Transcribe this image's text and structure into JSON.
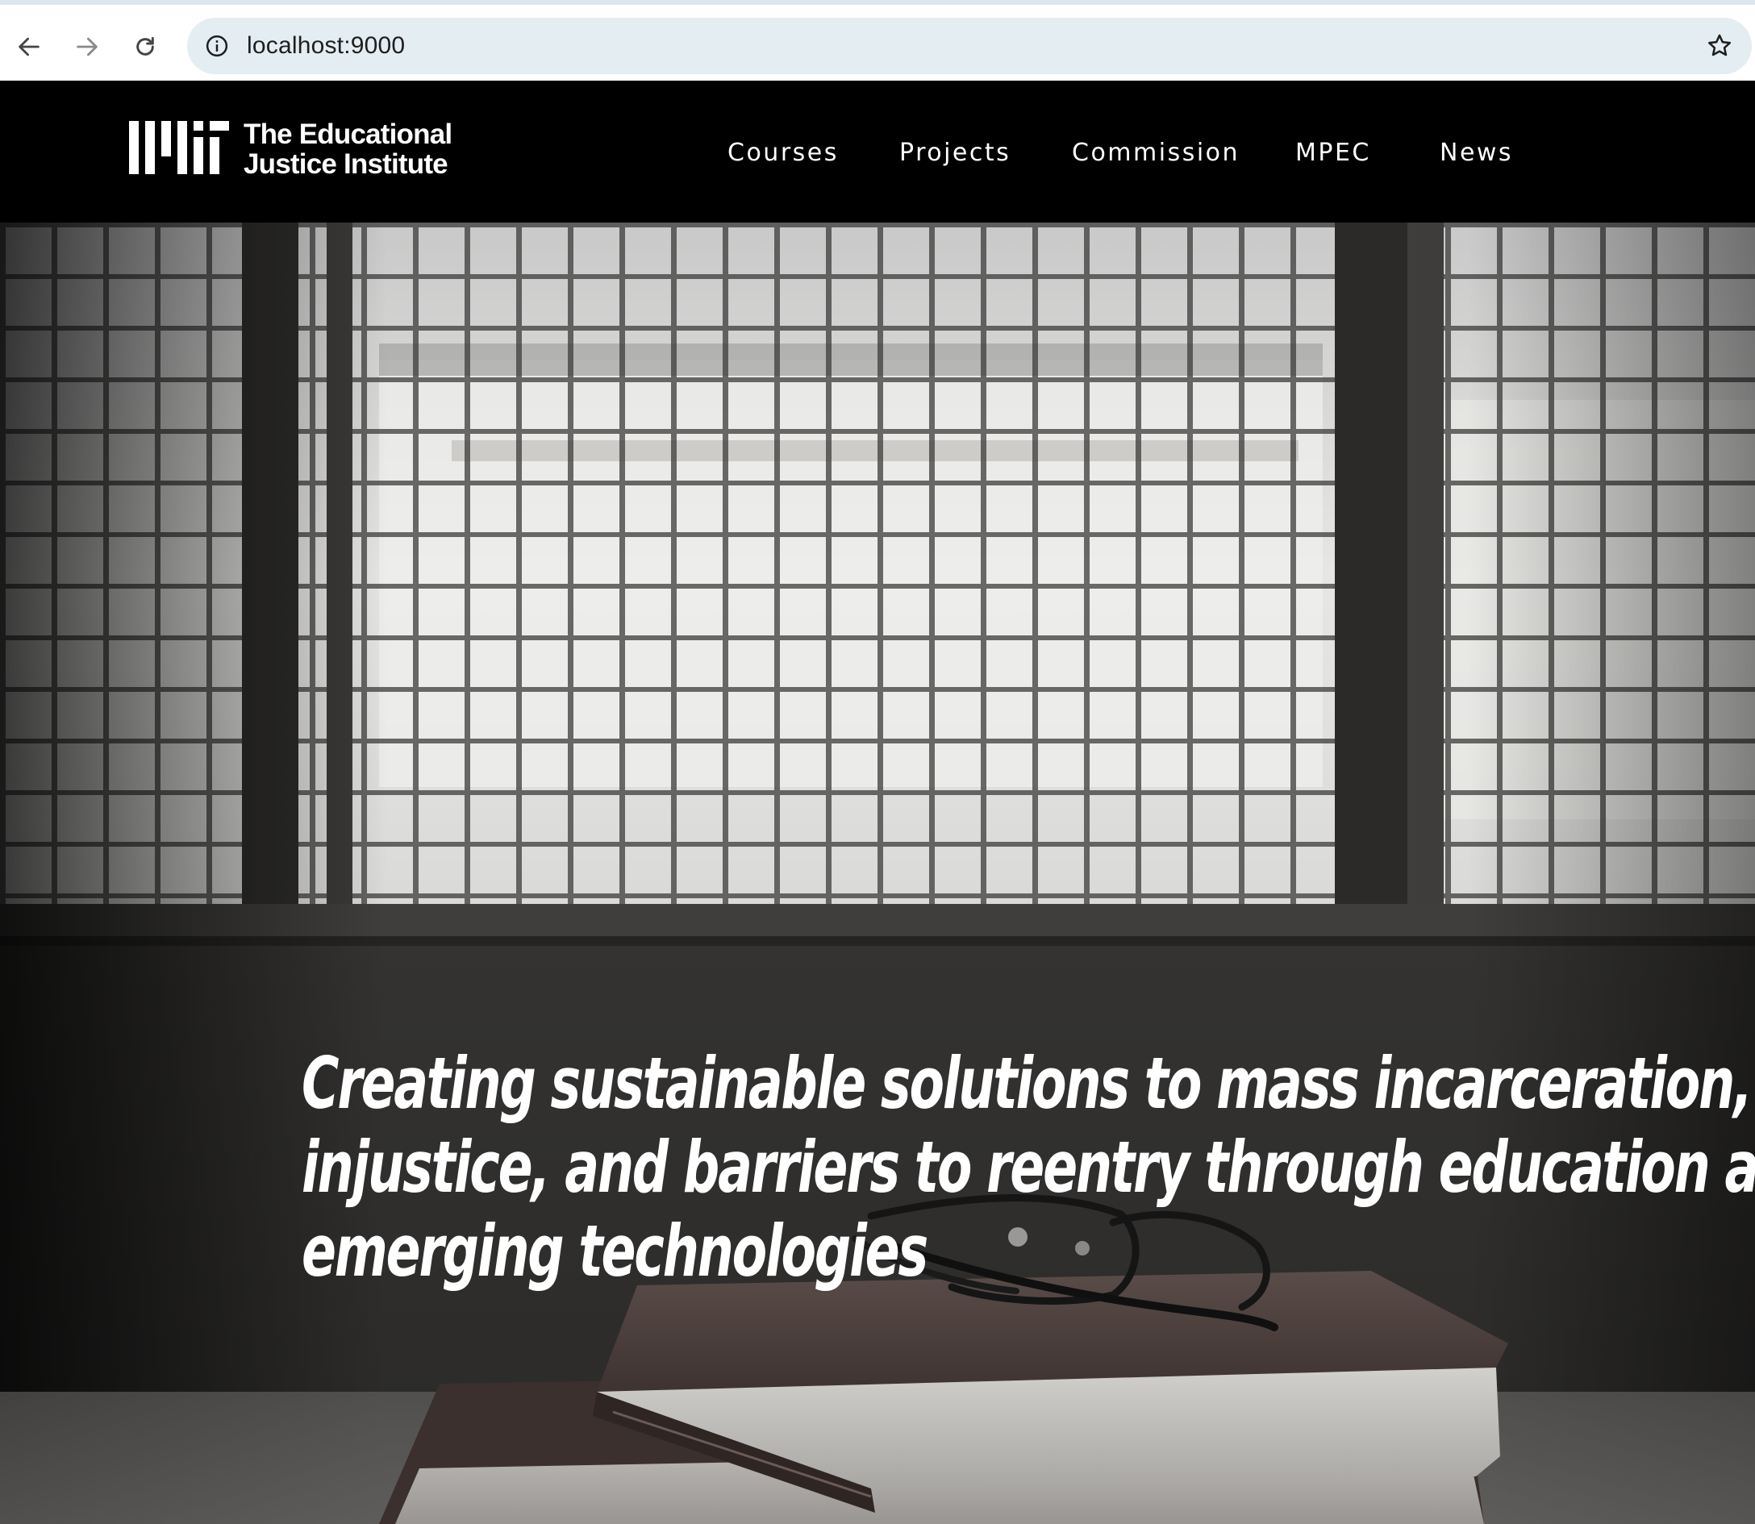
{
  "browser": {
    "url": "localhost:9000",
    "icons": {
      "back": "arrow-left-icon",
      "forward": "arrow-right-icon",
      "reload": "reload-icon",
      "site_info": "info-icon",
      "bookmark": "star-icon"
    }
  },
  "header": {
    "logo": {
      "mark": "MIT",
      "line1": "The Educational",
      "line2": "Justice Institute"
    },
    "nav": [
      {
        "label": "Courses"
      },
      {
        "label": "Projects"
      },
      {
        "label": "Commission"
      },
      {
        "label": "MPEC"
      },
      {
        "label": "News"
      }
    ]
  },
  "hero": {
    "title_lines": [
      "Creating sustainable solutions to mass incarceration, soc",
      "injustice, and barriers to reentry through education and",
      "emerging technologies"
    ]
  },
  "colors": {
    "header_bg": "#000000",
    "header_text": "#ffffff",
    "omnibox_bg": "#e3edf2",
    "hero_text": "#ffffff"
  }
}
